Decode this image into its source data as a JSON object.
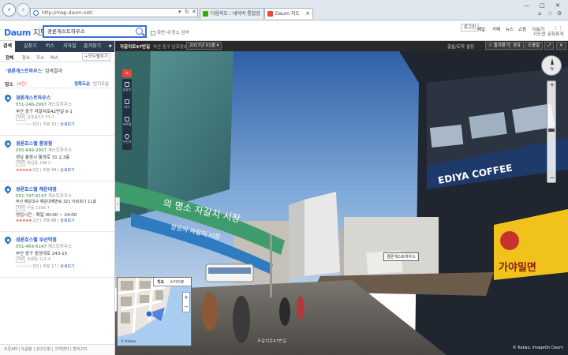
{
  "browser": {
    "address": "http://map.daum.net/",
    "tabs": [
      {
        "label": "다음지도 : 네이버 통합검색",
        "active": false
      },
      {
        "label": "Daum 지도",
        "active": true
      }
    ],
    "tab_close": "×",
    "win_minimize": "—",
    "win_maximize": "□",
    "win_close": "✕",
    "addr_icons": [
      "▾",
      "↻",
      "✕"
    ],
    "colors": {
      "accent": "#2a6be4"
    }
  },
  "site": {
    "logo": "Daum",
    "logo_sub": "지도",
    "search_value": "경론게스트하우스",
    "in_area_label": "화면 내 장소 검색",
    "menu": [
      "로그인",
      "메일",
      "카페",
      "뉴스",
      "쇼핑",
      "더보기"
    ],
    "sub_menu": [
      "지도앱",
      "문화휴게"
    ]
  },
  "left": {
    "cat_tabs": [
      "검색",
      "길찾기",
      "버스",
      "지하철",
      "즐겨찾기"
    ],
    "sub_tabs": [
      "전체",
      "장소",
      "주소",
      "버스"
    ],
    "open_all": "모두펼치기",
    "query_quoted": "'경론게스트하우스'",
    "query_suffix": " 검색결과",
    "places_label": "장소",
    "places_count": "(4건)",
    "sort_options": [
      "정확도순",
      "인기도순"
    ],
    "results": [
      {
        "name": "경론게스트하우스",
        "type": "",
        "phone": "051-246-2997",
        "type2": "게스트하우스",
        "addr": "부산 중구 자갈치로42번길 6-1",
        "old_addr": "남포동5가 53-1",
        "hours": "",
        "reviews": "0건",
        "blog": "리뷰 10",
        "more": "상세보기"
      },
      {
        "name": "경론호스텔 통영점",
        "type": "",
        "phone": "055-649-2997",
        "type2": "게스트하우스",
        "addr": "경남 통영시 통영로 31 2,3층",
        "old_addr": "항남동 188-2",
        "hours": "",
        "reviews": "2건",
        "blog": "리뷰 44",
        "more": "상세보기"
      },
      {
        "name": "경론호스텔 해운대점",
        "type": "",
        "phone": "051-747-6147",
        "type2": "게스트하우스",
        "addr": "부산 해운대구 해운대해변로 321 아르피나 11층",
        "old_addr": "우동 1396-7",
        "hours": "영업시간 : 매일 00:00 ~ 24:00",
        "reviews": "2건",
        "blog": "리뷰 88",
        "more": "상세보기"
      },
      {
        "name": "경론호스텔 부산역점",
        "type": "",
        "phone": "051-469-6147",
        "type2": "게스트하우스",
        "addr": "부산 중구 중앙대로 243-15",
        "old_addr": "초량동 111-4",
        "hours": "",
        "reviews": "0건",
        "blog": "리뷰 17",
        "more": "상세보기"
      }
    ],
    "footer_links": [
      "오픈API",
      "도움말",
      "광고신청",
      "고객센터",
      "법적고지"
    ],
    "ratings": [
      0,
      5,
      5,
      0
    ]
  },
  "roadview": {
    "title": "자갈치로47번길",
    "date_prefix": "부산 중구 남포동5가",
    "date_select": "2017년 01월",
    "top_right": [
      "출발/도착 설정",
      "즐겨찾기",
      "공유",
      "도움말"
    ],
    "tools": [
      "길찾기",
      "버스",
      "지하철",
      "자전거"
    ],
    "map_tabs": [
      "지도",
      "스카이뷰"
    ],
    "place_label": "경론게스트하우스",
    "road_label": "자갈치로47번길",
    "copyright": "© Kakao, ImageOn Daum",
    "mm_copyright": "© Kakao",
    "signs": [
      "EDIYA COFFEE",
      "가야밀면",
      "의 명소 자갈치 시장",
      "창원의 자갈치 시장"
    ],
    "compass_label": "N",
    "zoom_plus": "+",
    "zoom_minus": "−"
  }
}
